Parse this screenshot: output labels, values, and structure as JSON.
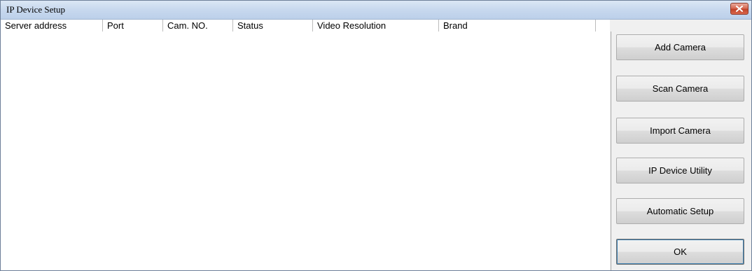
{
  "window": {
    "title": "IP Device Setup"
  },
  "table": {
    "columns": [
      "Server address",
      "Port",
      "Cam. NO.",
      "Status",
      "Video Resolution",
      "Brand"
    ],
    "rows": []
  },
  "buttons": {
    "add_camera": "Add Camera",
    "scan_camera": "Scan Camera",
    "import_camera": "Import Camera",
    "ip_device_utility": "IP Device Utility",
    "automatic_setup": "Automatic Setup",
    "ok": "OK"
  },
  "icons": {
    "close": "close-icon"
  }
}
